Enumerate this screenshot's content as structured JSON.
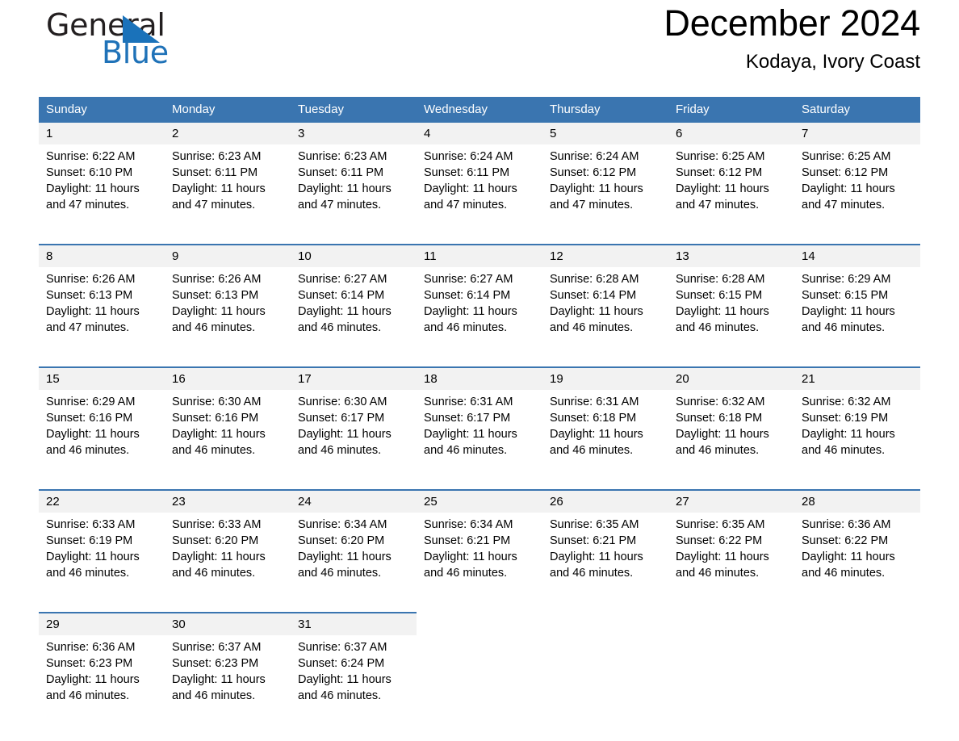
{
  "logo": {
    "word1": "General",
    "word2": "Blue",
    "triangle_color": "#1a72ba",
    "text_color": "#231f20"
  },
  "header": {
    "month_title": "December 2024",
    "location": "Kodaya, Ivory Coast"
  },
  "theme": {
    "header_bg": "#3a75b0",
    "header_text": "#ffffff",
    "daynum_bg": "#f2f2f2",
    "cell_bg": "#ffffff",
    "rule_color": "#3a75b0"
  },
  "weekdays": [
    "Sunday",
    "Monday",
    "Tuesday",
    "Wednesday",
    "Thursday",
    "Friday",
    "Saturday"
  ],
  "weeks": [
    {
      "days": [
        {
          "num": "1",
          "sunrise": "Sunrise: 6:22 AM",
          "sunset": "Sunset: 6:10 PM",
          "daylight1": "Daylight: 11 hours",
          "daylight2": "and 47 minutes."
        },
        {
          "num": "2",
          "sunrise": "Sunrise: 6:23 AM",
          "sunset": "Sunset: 6:11 PM",
          "daylight1": "Daylight: 11 hours",
          "daylight2": "and 47 minutes."
        },
        {
          "num": "3",
          "sunrise": "Sunrise: 6:23 AM",
          "sunset": "Sunset: 6:11 PM",
          "daylight1": "Daylight: 11 hours",
          "daylight2": "and 47 minutes."
        },
        {
          "num": "4",
          "sunrise": "Sunrise: 6:24 AM",
          "sunset": "Sunset: 6:11 PM",
          "daylight1": "Daylight: 11 hours",
          "daylight2": "and 47 minutes."
        },
        {
          "num": "5",
          "sunrise": "Sunrise: 6:24 AM",
          "sunset": "Sunset: 6:12 PM",
          "daylight1": "Daylight: 11 hours",
          "daylight2": "and 47 minutes."
        },
        {
          "num": "6",
          "sunrise": "Sunrise: 6:25 AM",
          "sunset": "Sunset: 6:12 PM",
          "daylight1": "Daylight: 11 hours",
          "daylight2": "and 47 minutes."
        },
        {
          "num": "7",
          "sunrise": "Sunrise: 6:25 AM",
          "sunset": "Sunset: 6:12 PM",
          "daylight1": "Daylight: 11 hours",
          "daylight2": "and 47 minutes."
        }
      ]
    },
    {
      "days": [
        {
          "num": "8",
          "sunrise": "Sunrise: 6:26 AM",
          "sunset": "Sunset: 6:13 PM",
          "daylight1": "Daylight: 11 hours",
          "daylight2": "and 47 minutes."
        },
        {
          "num": "9",
          "sunrise": "Sunrise: 6:26 AM",
          "sunset": "Sunset: 6:13 PM",
          "daylight1": "Daylight: 11 hours",
          "daylight2": "and 46 minutes."
        },
        {
          "num": "10",
          "sunrise": "Sunrise: 6:27 AM",
          "sunset": "Sunset: 6:14 PM",
          "daylight1": "Daylight: 11 hours",
          "daylight2": "and 46 minutes."
        },
        {
          "num": "11",
          "sunrise": "Sunrise: 6:27 AM",
          "sunset": "Sunset: 6:14 PM",
          "daylight1": "Daylight: 11 hours",
          "daylight2": "and 46 minutes."
        },
        {
          "num": "12",
          "sunrise": "Sunrise: 6:28 AM",
          "sunset": "Sunset: 6:14 PM",
          "daylight1": "Daylight: 11 hours",
          "daylight2": "and 46 minutes."
        },
        {
          "num": "13",
          "sunrise": "Sunrise: 6:28 AM",
          "sunset": "Sunset: 6:15 PM",
          "daylight1": "Daylight: 11 hours",
          "daylight2": "and 46 minutes."
        },
        {
          "num": "14",
          "sunrise": "Sunrise: 6:29 AM",
          "sunset": "Sunset: 6:15 PM",
          "daylight1": "Daylight: 11 hours",
          "daylight2": "and 46 minutes."
        }
      ]
    },
    {
      "days": [
        {
          "num": "15",
          "sunrise": "Sunrise: 6:29 AM",
          "sunset": "Sunset: 6:16 PM",
          "daylight1": "Daylight: 11 hours",
          "daylight2": "and 46 minutes."
        },
        {
          "num": "16",
          "sunrise": "Sunrise: 6:30 AM",
          "sunset": "Sunset: 6:16 PM",
          "daylight1": "Daylight: 11 hours",
          "daylight2": "and 46 minutes."
        },
        {
          "num": "17",
          "sunrise": "Sunrise: 6:30 AM",
          "sunset": "Sunset: 6:17 PM",
          "daylight1": "Daylight: 11 hours",
          "daylight2": "and 46 minutes."
        },
        {
          "num": "18",
          "sunrise": "Sunrise: 6:31 AM",
          "sunset": "Sunset: 6:17 PM",
          "daylight1": "Daylight: 11 hours",
          "daylight2": "and 46 minutes."
        },
        {
          "num": "19",
          "sunrise": "Sunrise: 6:31 AM",
          "sunset": "Sunset: 6:18 PM",
          "daylight1": "Daylight: 11 hours",
          "daylight2": "and 46 minutes."
        },
        {
          "num": "20",
          "sunrise": "Sunrise: 6:32 AM",
          "sunset": "Sunset: 6:18 PM",
          "daylight1": "Daylight: 11 hours",
          "daylight2": "and 46 minutes."
        },
        {
          "num": "21",
          "sunrise": "Sunrise: 6:32 AM",
          "sunset": "Sunset: 6:19 PM",
          "daylight1": "Daylight: 11 hours",
          "daylight2": "and 46 minutes."
        }
      ]
    },
    {
      "days": [
        {
          "num": "22",
          "sunrise": "Sunrise: 6:33 AM",
          "sunset": "Sunset: 6:19 PM",
          "daylight1": "Daylight: 11 hours",
          "daylight2": "and 46 minutes."
        },
        {
          "num": "23",
          "sunrise": "Sunrise: 6:33 AM",
          "sunset": "Sunset: 6:20 PM",
          "daylight1": "Daylight: 11 hours",
          "daylight2": "and 46 minutes."
        },
        {
          "num": "24",
          "sunrise": "Sunrise: 6:34 AM",
          "sunset": "Sunset: 6:20 PM",
          "daylight1": "Daylight: 11 hours",
          "daylight2": "and 46 minutes."
        },
        {
          "num": "25",
          "sunrise": "Sunrise: 6:34 AM",
          "sunset": "Sunset: 6:21 PM",
          "daylight1": "Daylight: 11 hours",
          "daylight2": "and 46 minutes."
        },
        {
          "num": "26",
          "sunrise": "Sunrise: 6:35 AM",
          "sunset": "Sunset: 6:21 PM",
          "daylight1": "Daylight: 11 hours",
          "daylight2": "and 46 minutes."
        },
        {
          "num": "27",
          "sunrise": "Sunrise: 6:35 AM",
          "sunset": "Sunset: 6:22 PM",
          "daylight1": "Daylight: 11 hours",
          "daylight2": "and 46 minutes."
        },
        {
          "num": "28",
          "sunrise": "Sunrise: 6:36 AM",
          "sunset": "Sunset: 6:22 PM",
          "daylight1": "Daylight: 11 hours",
          "daylight2": "and 46 minutes."
        }
      ]
    },
    {
      "days": [
        {
          "num": "29",
          "sunrise": "Sunrise: 6:36 AM",
          "sunset": "Sunset: 6:23 PM",
          "daylight1": "Daylight: 11 hours",
          "daylight2": "and 46 minutes."
        },
        {
          "num": "30",
          "sunrise": "Sunrise: 6:37 AM",
          "sunset": "Sunset: 6:23 PM",
          "daylight1": "Daylight: 11 hours",
          "daylight2": "and 46 minutes."
        },
        {
          "num": "31",
          "sunrise": "Sunrise: 6:37 AM",
          "sunset": "Sunset: 6:24 PM",
          "daylight1": "Daylight: 11 hours",
          "daylight2": "and 46 minutes."
        },
        {
          "num": "",
          "sunrise": "",
          "sunset": "",
          "daylight1": "",
          "daylight2": ""
        },
        {
          "num": "",
          "sunrise": "",
          "sunset": "",
          "daylight1": "",
          "daylight2": ""
        },
        {
          "num": "",
          "sunrise": "",
          "sunset": "",
          "daylight1": "",
          "daylight2": ""
        },
        {
          "num": "",
          "sunrise": "",
          "sunset": "",
          "daylight1": "",
          "daylight2": ""
        }
      ]
    }
  ]
}
